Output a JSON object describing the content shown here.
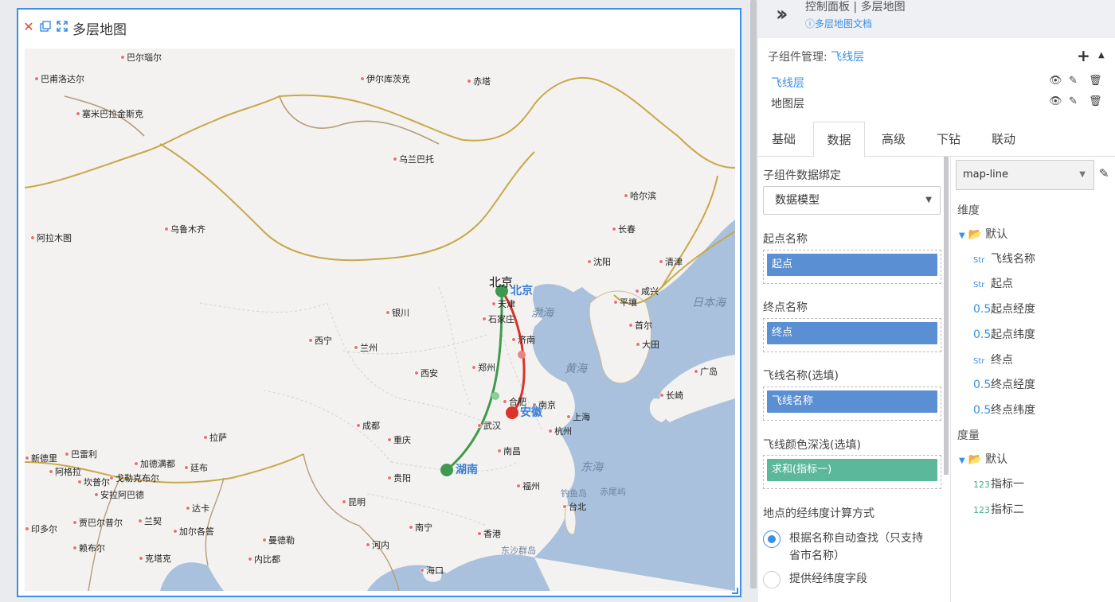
{
  "widget": {
    "title": "多层地图",
    "close_icon": "close-icon",
    "copy_icon": "copy-icon",
    "fullscreen_icon": "fullscreen-icon"
  },
  "map": {
    "cities": [
      {
        "name": "巴尔瑙尔"
      },
      {
        "name": "巴甫洛达尔"
      },
      {
        "name": "伊尔库茨克"
      },
      {
        "name": "赤塔"
      },
      {
        "name": "塞米巴拉金斯克"
      },
      {
        "name": "乌兰巴托"
      },
      {
        "name": "哈尔滨"
      },
      {
        "name": "乌鲁木齐"
      },
      {
        "name": "长春"
      },
      {
        "name": "阿拉木图"
      },
      {
        "name": "沈阳"
      },
      {
        "name": "清津"
      },
      {
        "name": "天津"
      },
      {
        "name": "咸兴"
      },
      {
        "name": "银川"
      },
      {
        "name": "石家庄"
      },
      {
        "name": "平壤"
      },
      {
        "name": "首尔"
      },
      {
        "name": "西宁"
      },
      {
        "name": "兰州"
      },
      {
        "name": "济南"
      },
      {
        "name": "大田"
      },
      {
        "name": "郑州"
      },
      {
        "name": "西安"
      },
      {
        "name": "广岛"
      },
      {
        "name": "长崎"
      },
      {
        "name": "合肥"
      },
      {
        "name": "南京"
      },
      {
        "name": "上海"
      },
      {
        "name": "成都"
      },
      {
        "name": "武汉"
      },
      {
        "name": "拉萨"
      },
      {
        "name": "重庆"
      },
      {
        "name": "杭州"
      },
      {
        "name": "新德里"
      },
      {
        "name": "巴雷利"
      },
      {
        "name": "加德满都"
      },
      {
        "name": "廷布"
      },
      {
        "name": "南昌"
      },
      {
        "name": "阿格拉"
      },
      {
        "name": "坎普尔"
      },
      {
        "name": "戈勒克布尔"
      },
      {
        "name": "贵阳"
      },
      {
        "name": "安拉阿巴德"
      },
      {
        "name": "福州"
      },
      {
        "name": "达卡"
      },
      {
        "name": "昆明"
      },
      {
        "name": "兰契"
      },
      {
        "name": "贾巴尔普尔"
      },
      {
        "name": "台北"
      },
      {
        "name": "印多尔"
      },
      {
        "name": "加尔各答"
      },
      {
        "name": "南宁"
      },
      {
        "name": "香港"
      },
      {
        "name": "曼德勒"
      },
      {
        "name": "赖布尔"
      },
      {
        "name": "河内"
      },
      {
        "name": "克塔克"
      },
      {
        "name": "内比都"
      },
      {
        "name": "海口"
      }
    ],
    "capital_label": "北京",
    "seas": [
      "渤海",
      "黄海",
      "日本海",
      "东海",
      "钓鱼岛",
      "赤尾屿",
      "东沙群岛"
    ],
    "regions": {
      "beijing": "北京",
      "anhui": "安徽",
      "hunan": "湖南"
    },
    "flight_line_colors": {
      "red": "#d9342b",
      "green": "#3f9a4f"
    }
  },
  "panel": {
    "title": "控制面板 | 多层地图",
    "doc_link": "多层地图文档",
    "sub_manage_label": "子组件管理:",
    "sub_manage_current": "飞线层",
    "layers": [
      {
        "name": "飞线层",
        "active": true
      },
      {
        "name": "地图层",
        "active": false
      }
    ],
    "tabs": [
      "基础",
      "数据",
      "高级",
      "下钻",
      "联动"
    ],
    "active_tab": "数据",
    "binding": {
      "section_label": "子组件数据绑定",
      "model_select": "数据模型",
      "start_label": "起点名称",
      "start_chip": "起点",
      "end_label": "终点名称",
      "end_chip": "终点",
      "flyname_label": "飞线名称(选填)",
      "flyname_chip": "飞线名称",
      "color_label": "飞线颜色深浅(选填)",
      "color_chip": "求和(指标一)",
      "calc_label": "地点的经纬度计算方式",
      "radio_auto": "根据名称自动查找（只支持省市名称）",
      "radio_field": "提供经纬度字段"
    },
    "fields": {
      "dataset": "map-line",
      "dim_label": "维度",
      "dim_folder": "默认",
      "dims": [
        {
          "type": "Str",
          "name": "飞线名称"
        },
        {
          "type": "Str",
          "name": "起点"
        },
        {
          "type": "0.5",
          "name": "起点经度"
        },
        {
          "type": "0.5",
          "name": "起点纬度"
        },
        {
          "type": "Str",
          "name": "终点"
        },
        {
          "type": "0.5",
          "name": "终点经度"
        },
        {
          "type": "0.5",
          "name": "终点纬度"
        }
      ],
      "measure_label": "度量",
      "measure_folder": "默认",
      "measures": [
        {
          "type": "123",
          "name": "指标一"
        },
        {
          "type": "123",
          "name": "指标二"
        }
      ]
    }
  }
}
